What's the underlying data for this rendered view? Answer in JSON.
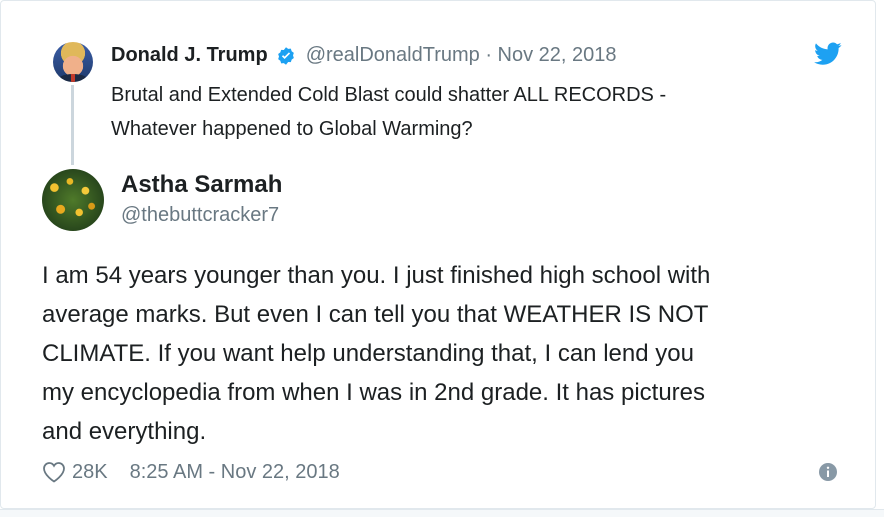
{
  "quoted_tweet": {
    "author_name": "Donald J. Trump",
    "meta": "@realDonaldTrump · Nov 22, 2018",
    "text": "Brutal and Extended Cold Blast could shatter ALL RECORDS -\nWhatever happened to Global Warming?"
  },
  "reply": {
    "author_name": "Astha Sarmah",
    "handle": "@thebuttcracker7",
    "text": "I am 54 years younger than you. I just finished high school with\naverage marks. But even I can tell you that  WEATHER IS NOT\nCLIMATE. If you want help understanding that, I can lend you\nmy encyclopedia from when I was in 2nd grade. It has pictures\nand everything."
  },
  "footer": {
    "likes": "28K",
    "timestamp": "8:25 AM - Nov 22, 2018"
  },
  "icons": {
    "verified": "verified-badge-icon",
    "twitter": "twitter-bird-icon",
    "heart": "heart-icon",
    "info": "info-icon"
  },
  "colors": {
    "twitter_blue": "#1da1f2",
    "muted_gray": "#697882",
    "text": "#1c2022"
  }
}
